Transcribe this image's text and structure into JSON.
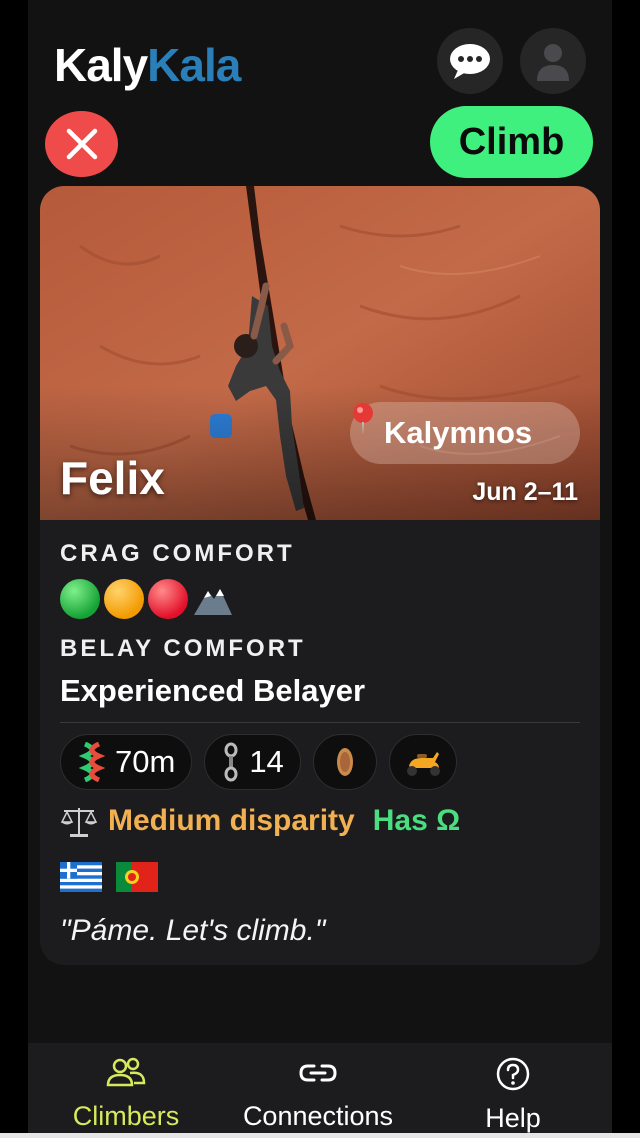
{
  "app": {
    "logo_part1": "Kaly",
    "logo_part2": "Kala",
    "brand_color": "#2b7fb8"
  },
  "header": {
    "chat_icon": "speech-bubble-icon",
    "profile_icon": "user-silhouette-icon"
  },
  "actions": {
    "close_icon": "close-x-icon",
    "climb_label": "Climb",
    "climb_color": "#3ff07f",
    "close_color": "#f04b4b"
  },
  "profile": {
    "name": "Felix",
    "location_icon": "pushpin-icon",
    "location": "Kalymnos",
    "dates": "Jun 2–11",
    "crag_comfort_label": "CRAG COMFORT",
    "crag_comfort_icons": [
      "green-circle",
      "orange-circle",
      "red-circle",
      "mountain-icon"
    ],
    "belay_comfort_label": "BELAY COMFORT",
    "belay_comfort_value": "Experienced Belayer",
    "gear": [
      {
        "icon": "rope-icon",
        "value": "70m"
      },
      {
        "icon": "quickdraw-icon",
        "value": "14"
      },
      {
        "icon": "crash-pad-icon",
        "value": ""
      },
      {
        "icon": "scooter-icon",
        "value": ""
      }
    ],
    "disparity_icon": "balance-scale-icon",
    "disparity": "Medium disparity",
    "has_omega": "Has Ω",
    "flags": [
      "greece-flag",
      "portugal-flag"
    ],
    "quote": "\"Páme. Let's climb.\""
  },
  "nav": {
    "items": [
      {
        "label": "Climbers",
        "icon": "people-icon",
        "active": true
      },
      {
        "label": "Connections",
        "icon": "link-icon",
        "active": false
      },
      {
        "label": "Help",
        "icon": "help-circle-icon",
        "active": false
      }
    ],
    "active_color": "#d7ea5c"
  }
}
